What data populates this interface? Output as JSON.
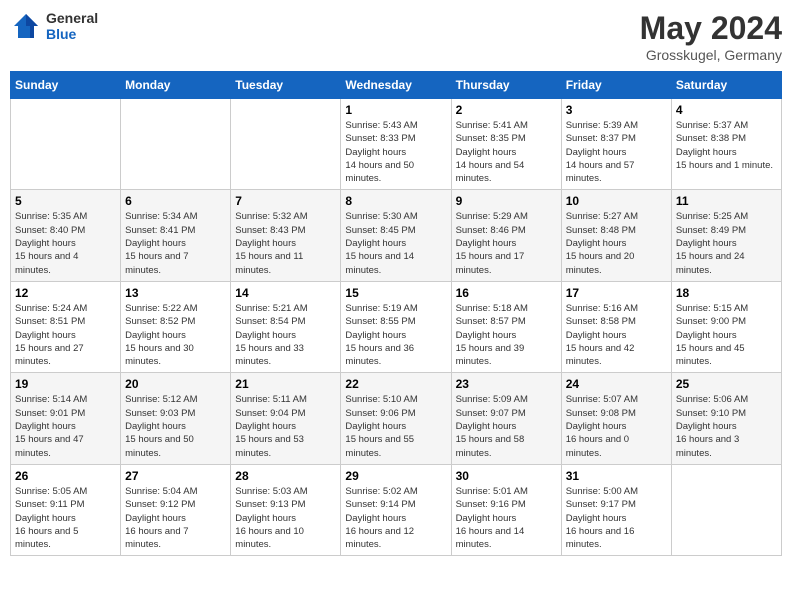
{
  "header": {
    "logo_general": "General",
    "logo_blue": "Blue",
    "month_year": "May 2024",
    "location": "Grosskugel, Germany"
  },
  "calendar": {
    "days_of_week": [
      "Sunday",
      "Monday",
      "Tuesday",
      "Wednesday",
      "Thursday",
      "Friday",
      "Saturday"
    ],
    "weeks": [
      [
        {
          "day": "",
          "empty": true
        },
        {
          "day": "",
          "empty": true
        },
        {
          "day": "",
          "empty": true
        },
        {
          "day": "1",
          "sunrise": "5:43 AM",
          "sunset": "8:33 PM",
          "daylight": "14 hours and 50 minutes."
        },
        {
          "day": "2",
          "sunrise": "5:41 AM",
          "sunset": "8:35 PM",
          "daylight": "14 hours and 54 minutes."
        },
        {
          "day": "3",
          "sunrise": "5:39 AM",
          "sunset": "8:37 PM",
          "daylight": "14 hours and 57 minutes."
        },
        {
          "day": "4",
          "sunrise": "5:37 AM",
          "sunset": "8:38 PM",
          "daylight": "15 hours and 1 minute."
        }
      ],
      [
        {
          "day": "5",
          "sunrise": "5:35 AM",
          "sunset": "8:40 PM",
          "daylight": "15 hours and 4 minutes."
        },
        {
          "day": "6",
          "sunrise": "5:34 AM",
          "sunset": "8:41 PM",
          "daylight": "15 hours and 7 minutes."
        },
        {
          "day": "7",
          "sunrise": "5:32 AM",
          "sunset": "8:43 PM",
          "daylight": "15 hours and 11 minutes."
        },
        {
          "day": "8",
          "sunrise": "5:30 AM",
          "sunset": "8:45 PM",
          "daylight": "15 hours and 14 minutes."
        },
        {
          "day": "9",
          "sunrise": "5:29 AM",
          "sunset": "8:46 PM",
          "daylight": "15 hours and 17 minutes."
        },
        {
          "day": "10",
          "sunrise": "5:27 AM",
          "sunset": "8:48 PM",
          "daylight": "15 hours and 20 minutes."
        },
        {
          "day": "11",
          "sunrise": "5:25 AM",
          "sunset": "8:49 PM",
          "daylight": "15 hours and 24 minutes."
        }
      ],
      [
        {
          "day": "12",
          "sunrise": "5:24 AM",
          "sunset": "8:51 PM",
          "daylight": "15 hours and 27 minutes."
        },
        {
          "day": "13",
          "sunrise": "5:22 AM",
          "sunset": "8:52 PM",
          "daylight": "15 hours and 30 minutes."
        },
        {
          "day": "14",
          "sunrise": "5:21 AM",
          "sunset": "8:54 PM",
          "daylight": "15 hours and 33 minutes."
        },
        {
          "day": "15",
          "sunrise": "5:19 AM",
          "sunset": "8:55 PM",
          "daylight": "15 hours and 36 minutes."
        },
        {
          "day": "16",
          "sunrise": "5:18 AM",
          "sunset": "8:57 PM",
          "daylight": "15 hours and 39 minutes."
        },
        {
          "day": "17",
          "sunrise": "5:16 AM",
          "sunset": "8:58 PM",
          "daylight": "15 hours and 42 minutes."
        },
        {
          "day": "18",
          "sunrise": "5:15 AM",
          "sunset": "9:00 PM",
          "daylight": "15 hours and 45 minutes."
        }
      ],
      [
        {
          "day": "19",
          "sunrise": "5:14 AM",
          "sunset": "9:01 PM",
          "daylight": "15 hours and 47 minutes."
        },
        {
          "day": "20",
          "sunrise": "5:12 AM",
          "sunset": "9:03 PM",
          "daylight": "15 hours and 50 minutes."
        },
        {
          "day": "21",
          "sunrise": "5:11 AM",
          "sunset": "9:04 PM",
          "daylight": "15 hours and 53 minutes."
        },
        {
          "day": "22",
          "sunrise": "5:10 AM",
          "sunset": "9:06 PM",
          "daylight": "15 hours and 55 minutes."
        },
        {
          "day": "23",
          "sunrise": "5:09 AM",
          "sunset": "9:07 PM",
          "daylight": "15 hours and 58 minutes."
        },
        {
          "day": "24",
          "sunrise": "5:07 AM",
          "sunset": "9:08 PM",
          "daylight": "16 hours and 0 minutes."
        },
        {
          "day": "25",
          "sunrise": "5:06 AM",
          "sunset": "9:10 PM",
          "daylight": "16 hours and 3 minutes."
        }
      ],
      [
        {
          "day": "26",
          "sunrise": "5:05 AM",
          "sunset": "9:11 PM",
          "daylight": "16 hours and 5 minutes."
        },
        {
          "day": "27",
          "sunrise": "5:04 AM",
          "sunset": "9:12 PM",
          "daylight": "16 hours and 7 minutes."
        },
        {
          "day": "28",
          "sunrise": "5:03 AM",
          "sunset": "9:13 PM",
          "daylight": "16 hours and 10 minutes."
        },
        {
          "day": "29",
          "sunrise": "5:02 AM",
          "sunset": "9:14 PM",
          "daylight": "16 hours and 12 minutes."
        },
        {
          "day": "30",
          "sunrise": "5:01 AM",
          "sunset": "9:16 PM",
          "daylight": "16 hours and 14 minutes."
        },
        {
          "day": "31",
          "sunrise": "5:00 AM",
          "sunset": "9:17 PM",
          "daylight": "16 hours and 16 minutes."
        },
        {
          "day": "",
          "empty": true
        }
      ]
    ],
    "labels": {
      "sunrise": "Sunrise:",
      "sunset": "Sunset:",
      "daylight": "Daylight hours"
    }
  }
}
